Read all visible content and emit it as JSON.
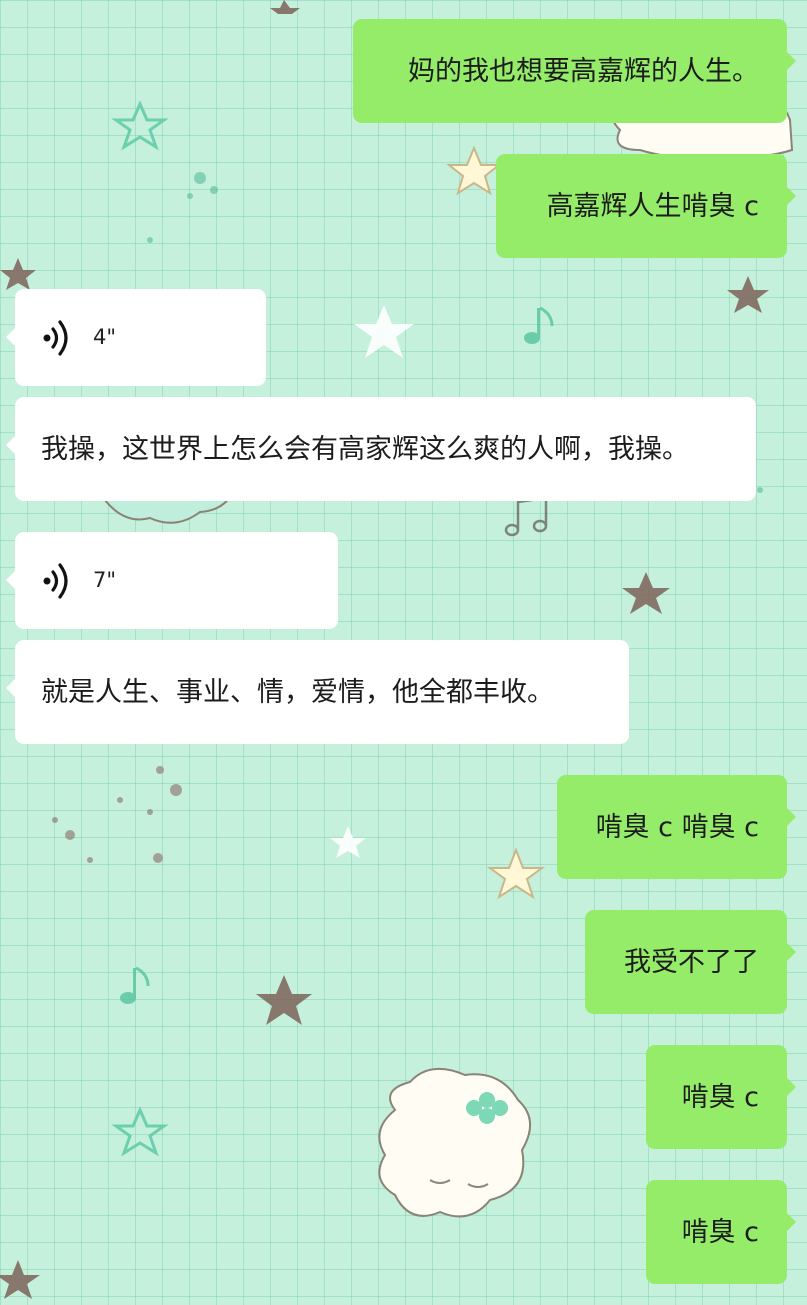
{
  "theme": {
    "background": "#c4f0dc",
    "outgoing_bubble": "#95ec69",
    "incoming_bubble": "#ffffff"
  },
  "messages": [
    {
      "direction": "outgoing",
      "kind": "text",
      "text": "妈的我也想要高嘉辉的人生。"
    },
    {
      "direction": "outgoing",
      "kind": "text",
      "text": "高嘉辉人生啃臭 c"
    },
    {
      "direction": "incoming",
      "kind": "voice",
      "duration": "4\"",
      "icon": "voice-wave-icon"
    },
    {
      "direction": "incoming",
      "kind": "text",
      "text": "我操，这世界上怎么会有高家辉这么爽的人啊，我操。"
    },
    {
      "direction": "incoming",
      "kind": "voice",
      "duration": "7\"",
      "icon": "voice-wave-icon"
    },
    {
      "direction": "incoming",
      "kind": "text",
      "text": "就是人生、事业、情，爱情，他全都丰收。"
    },
    {
      "direction": "outgoing",
      "kind": "text",
      "text": "啃臭 c 啃臭 c"
    },
    {
      "direction": "outgoing",
      "kind": "text",
      "text": "我受不了了"
    },
    {
      "direction": "outgoing",
      "kind": "text",
      "text": "啃臭 c"
    },
    {
      "direction": "outgoing",
      "kind": "text",
      "text": "啃臭 c"
    }
  ]
}
